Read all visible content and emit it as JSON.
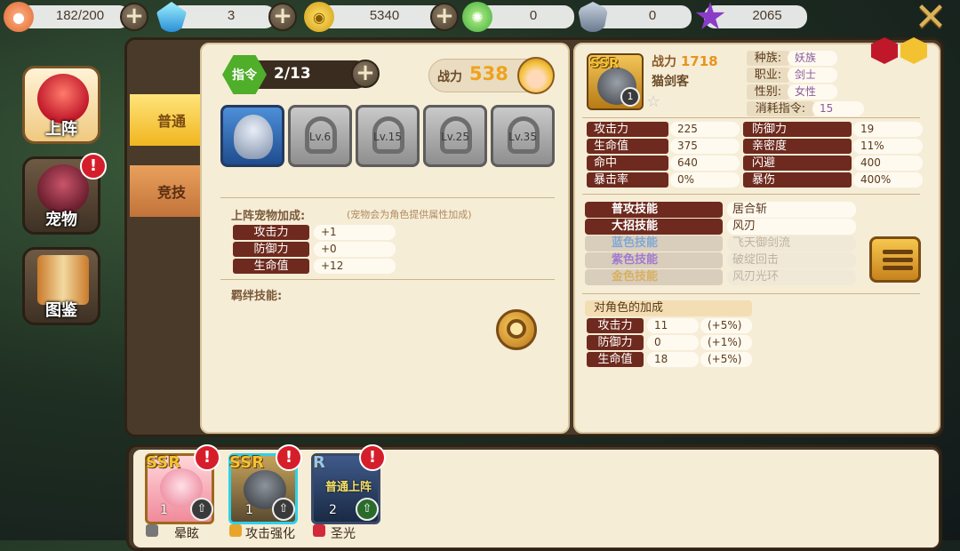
{
  "resources": [
    {
      "icon": "peach-icon",
      "value": "182/200"
    },
    {
      "icon": "blue-gem-icon",
      "value": "3"
    },
    {
      "icon": "gold-coin-icon",
      "value": "5340"
    },
    {
      "icon": "lollipop-icon",
      "value": "0"
    },
    {
      "icon": "rank-emblem-icon",
      "value": "0"
    },
    {
      "icon": "purple-star-icon",
      "value": "2065"
    }
  ],
  "nav": {
    "items": [
      {
        "label": "上阵",
        "active": true
      },
      {
        "label": "宠物",
        "active": false,
        "alert": "!"
      },
      {
        "label": "图鉴",
        "active": false
      }
    ]
  },
  "tabs": [
    "普通",
    "竞技"
  ],
  "command": {
    "badge": "指令",
    "count": "2/13"
  },
  "power": {
    "label": "战力",
    "value": "538"
  },
  "slots": [
    {
      "locked": false,
      "label": ""
    },
    {
      "locked": true,
      "label": "Lv.6"
    },
    {
      "locked": true,
      "label": "Lv.15"
    },
    {
      "locked": true,
      "label": "Lv.25"
    },
    {
      "locked": true,
      "label": "Lv.35"
    }
  ],
  "pet_bonus": {
    "title": "上阵宠物加成:",
    "note": "(宠物会为角色提供属性加成)",
    "rows": [
      {
        "label": "攻击力",
        "value": "+1"
      },
      {
        "label": "防御力",
        "value": "+0"
      },
      {
        "label": "生命值",
        "value": "+12"
      }
    ]
  },
  "bond_title": "羁绊技能:",
  "hero": {
    "rank": "SSR",
    "level_badge": "1",
    "power_label": "战力",
    "power_value": "1718",
    "name": "猫剑客",
    "info": [
      {
        "label": "种族:",
        "value": "妖族"
      },
      {
        "label": "职业:",
        "value": "剑士"
      },
      {
        "label": "性别:",
        "value": "女性"
      },
      {
        "label": "消耗指令:",
        "value": "15"
      }
    ],
    "stats": [
      {
        "label": "攻击力",
        "value": "225",
        "label2": "防御力",
        "value2": "19"
      },
      {
        "label": "生命值",
        "value": "375",
        "label2": "亲密度",
        "value2": "11%"
      },
      {
        "label": "命中",
        "value": "640",
        "label2": "闪避",
        "value2": "400"
      },
      {
        "label": "暴击率",
        "value": "0%",
        "label2": "暴伤",
        "value2": "400%"
      }
    ],
    "skills": [
      {
        "label": "普攻技能",
        "value": "居合斩",
        "locked": false
      },
      {
        "label": "大招技能",
        "value": "风刃",
        "locked": false
      },
      {
        "label": "蓝色技能",
        "value": "飞天御剑流",
        "locked": true,
        "color": "#7fa8d6"
      },
      {
        "label": "紫色技能",
        "value": "破绽回击",
        "locked": true,
        "color": "#a07ad0"
      },
      {
        "label": "金色技能",
        "value": "风刃光环",
        "locked": true,
        "color": "#d8b060"
      }
    ],
    "bonus": {
      "title": "对角色的加成",
      "rows": [
        {
          "label": "攻击力",
          "value": "11",
          "pct": "(+5%)"
        },
        {
          "label": "防御力",
          "value": "0",
          "pct": "(+1%)"
        },
        {
          "label": "生命值",
          "value": "18",
          "pct": "(+5%)"
        }
      ]
    }
  },
  "pets": [
    {
      "rank": "SSR",
      "level": "1",
      "name": "晕眩",
      "tag_icon": "stun-icon"
    },
    {
      "rank": "SSR",
      "level": "1",
      "name": "攻击强化",
      "tag_icon": "attack-up-icon"
    },
    {
      "rank": "R",
      "level": "2",
      "name": "圣光",
      "tag_icon": "holy-light-icon",
      "status": "普通上阵"
    }
  ],
  "colors": {
    "accent_gold": "#f0a21c",
    "stat_label_bg": "#6e2a1e",
    "panel_bg": "#f6edd7",
    "alert_red": "#d61e2b"
  }
}
